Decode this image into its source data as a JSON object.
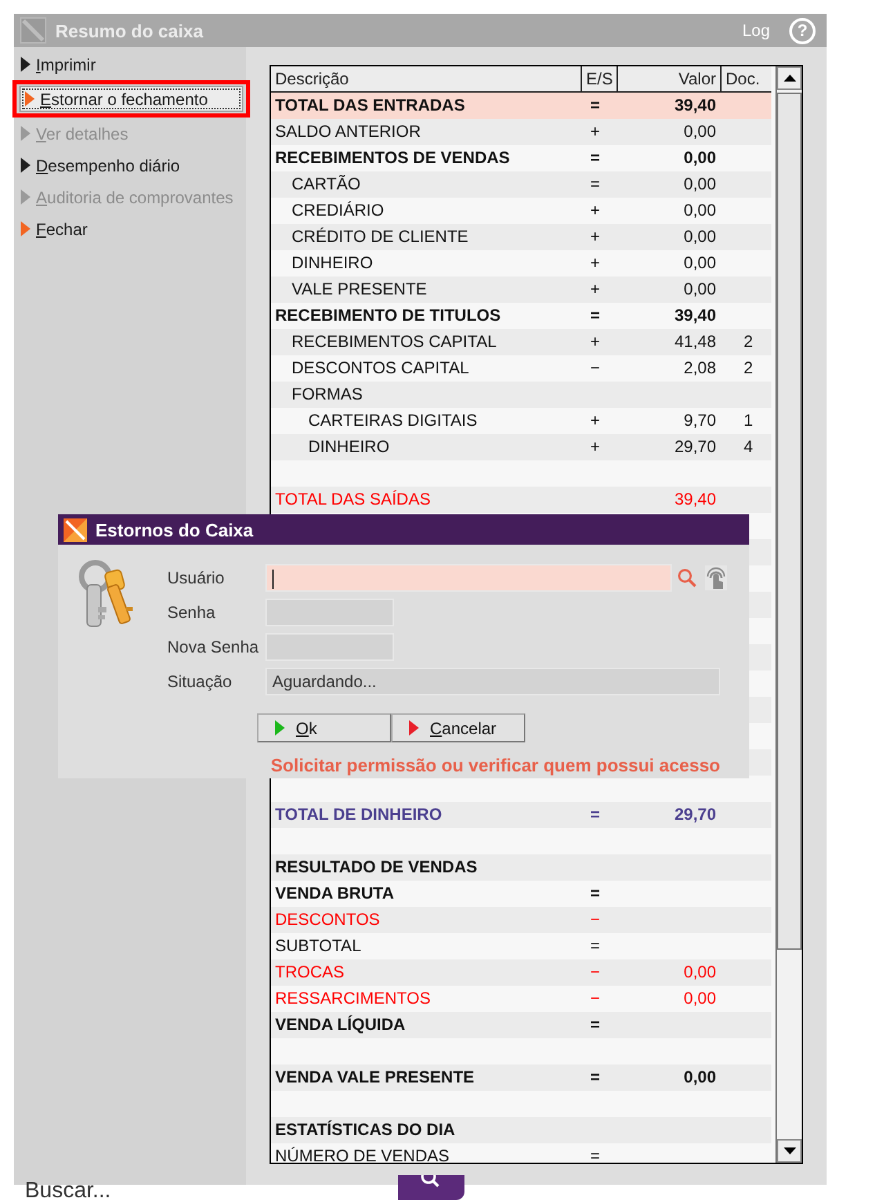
{
  "main_window": {
    "title": "Resumo do caixa",
    "log_label": "Log",
    "help_glyph": "?"
  },
  "sidebar": {
    "items": [
      {
        "label": "Imprimir",
        "disabled": false,
        "selected": false,
        "color": "#1e1e1e"
      },
      {
        "label": "Estornar o fechamento",
        "disabled": false,
        "selected": true,
        "color": "#f26522"
      },
      {
        "label": "Ver detalhes",
        "disabled": true,
        "selected": false,
        "color": "#9a9a9a"
      },
      {
        "label": "Desempenho diário",
        "disabled": false,
        "selected": false,
        "color": "#1e1e1e"
      },
      {
        "label": "Auditoria de comprovantes",
        "disabled": true,
        "selected": false,
        "color": "#9a9a9a"
      },
      {
        "label": "Fechar",
        "disabled": false,
        "selected": false,
        "color": "#f26522"
      }
    ]
  },
  "table": {
    "columns": [
      "Descrição",
      "E/S",
      "Valor",
      "Doc."
    ],
    "rows": [
      {
        "kind": "total",
        "description": "TOTAL DAS ENTRADAS",
        "sign": "=",
        "value": "39,40",
        "highlighted": true
      },
      {
        "kind": "line",
        "description": "SALDO ANTERIOR",
        "sign": "+",
        "value": "0,00",
        "highlighted": false
      },
      {
        "kind": "total",
        "description": "RECEBIMENTOS DE VENDAS",
        "sign": "=",
        "value": "0,00",
        "highlighted": false,
        "children": [
          {
            "kind": "line",
            "description": "CARTÃO",
            "sign": "=",
            "value": "0,00",
            "highlighted": false
          },
          {
            "kind": "line",
            "description": "CREDIÁRIO",
            "sign": "+",
            "value": "0,00",
            "highlighted": false
          },
          {
            "kind": "line",
            "description": "CRÉDITO DE CLIENTE",
            "sign": "+",
            "value": "0,00",
            "highlighted": false
          },
          {
            "kind": "line",
            "description": "DINHEIRO",
            "sign": "+",
            "value": "0,00",
            "highlighted": false
          },
          {
            "kind": "line",
            "description": "VALE PRESENTE",
            "sign": "+",
            "value": "0,00",
            "highlighted": false
          }
        ]
      },
      {
        "kind": "total",
        "description": "RECEBIMENTO DE TITULOS",
        "sign": "=",
        "value": "39,40",
        "highlighted": false,
        "children": [
          {
            "kind": "line",
            "description": "RECEBIMENTOS CAPITAL",
            "sign": "+",
            "value": "41,48",
            "doc": "2",
            "highlighted": false
          },
          {
            "kind": "line",
            "description": "DESCONTOS CAPITAL",
            "sign": "−",
            "value": "2,08",
            "doc": "2",
            "highlighted": false
          },
          {
            "kind": "line",
            "description": "FORMAS",
            "highlighted": false,
            "children": [
              {
                "kind": "line",
                "description": "CARTEIRAS DIGITAIS",
                "sign": "+",
                "value": "9,70",
                "doc": "1",
                "highlighted": false
              },
              {
                "kind": "line",
                "description": "DINHEIRO",
                "sign": "+",
                "value": "29,70",
                "doc": "4",
                "highlighted": false
              }
            ]
          }
        ]
      },
      {
        "kind": "spacer"
      },
      {
        "kind": "line",
        "description": "TOTAL DAS SAÍDAS",
        "value": "39,40",
        "highlighted": false,
        "color": "#ff0000"
      },
      {
        "kind": "spacer"
      },
      {
        "kind": "spacer"
      },
      {
        "kind": "spacer"
      },
      {
        "kind": "spacer"
      },
      {
        "kind": "spacer"
      },
      {
        "kind": "spacer"
      },
      {
        "kind": "spacer"
      },
      {
        "kind": "spacer"
      },
      {
        "kind": "spacer"
      },
      {
        "kind": "spacer"
      },
      {
        "kind": "spacer"
      },
      {
        "kind": "total",
        "description": "TOTAL DE DINHEIRO",
        "sign": "=",
        "value": "29,70",
        "highlighted": false,
        "color": "#4b3f8f"
      },
      {
        "kind": "spacer"
      },
      {
        "kind": "total",
        "description": "RESULTADO DE VENDAS",
        "highlighted": false
      },
      {
        "kind": "total",
        "description": "VENDA BRUTA",
        "sign": "=",
        "highlighted": false
      },
      {
        "kind": "line",
        "description": "DESCONTOS",
        "sign": "−",
        "highlighted": false,
        "color": "#ff0000"
      },
      {
        "kind": "line",
        "description": "SUBTOTAL",
        "sign": "=",
        "highlighted": false
      },
      {
        "kind": "line",
        "description": "TROCAS",
        "sign": "−",
        "value": "0,00",
        "highlighted": false,
        "color": "#ff0000"
      },
      {
        "kind": "line",
        "description": "RESSARCIMENTOS",
        "sign": "−",
        "value": "0,00",
        "highlighted": false,
        "color": "#ff0000"
      },
      {
        "kind": "total",
        "description": "VENDA LÍQUIDA",
        "sign": "=",
        "highlighted": false
      },
      {
        "kind": "spacer"
      },
      {
        "kind": "total",
        "description": "VENDA VALE PRESENTE",
        "sign": "=",
        "value": "0,00",
        "highlighted": false
      },
      {
        "kind": "spacer"
      },
      {
        "kind": "total",
        "description": "ESTATÍSTICAS DO DIA",
        "highlighted": false
      },
      {
        "kind": "line",
        "description": "NÚMERO DE VENDAS",
        "sign": "=",
        "highlighted": false
      }
    ]
  },
  "dialog": {
    "title": "Estornos do Caixa",
    "fields": [
      {
        "label": "Usuário",
        "kind": "lookup",
        "focused": true
      },
      {
        "label": "Senha",
        "kind": "short",
        "focused": false
      },
      {
        "label": "Nova Senha",
        "kind": "short",
        "focused": false
      },
      {
        "label": "Situação",
        "kind": "status",
        "focused": false,
        "value": "Aguardando..."
      }
    ],
    "buttons": [
      {
        "label": "Ok",
        "color": "#1cb81c"
      },
      {
        "label": "Cancelar",
        "color": "#e8202a"
      }
    ],
    "message": "Solicitar permissão ou verificar quem possui acesso"
  },
  "search": {
    "placeholder": "Buscar..."
  }
}
